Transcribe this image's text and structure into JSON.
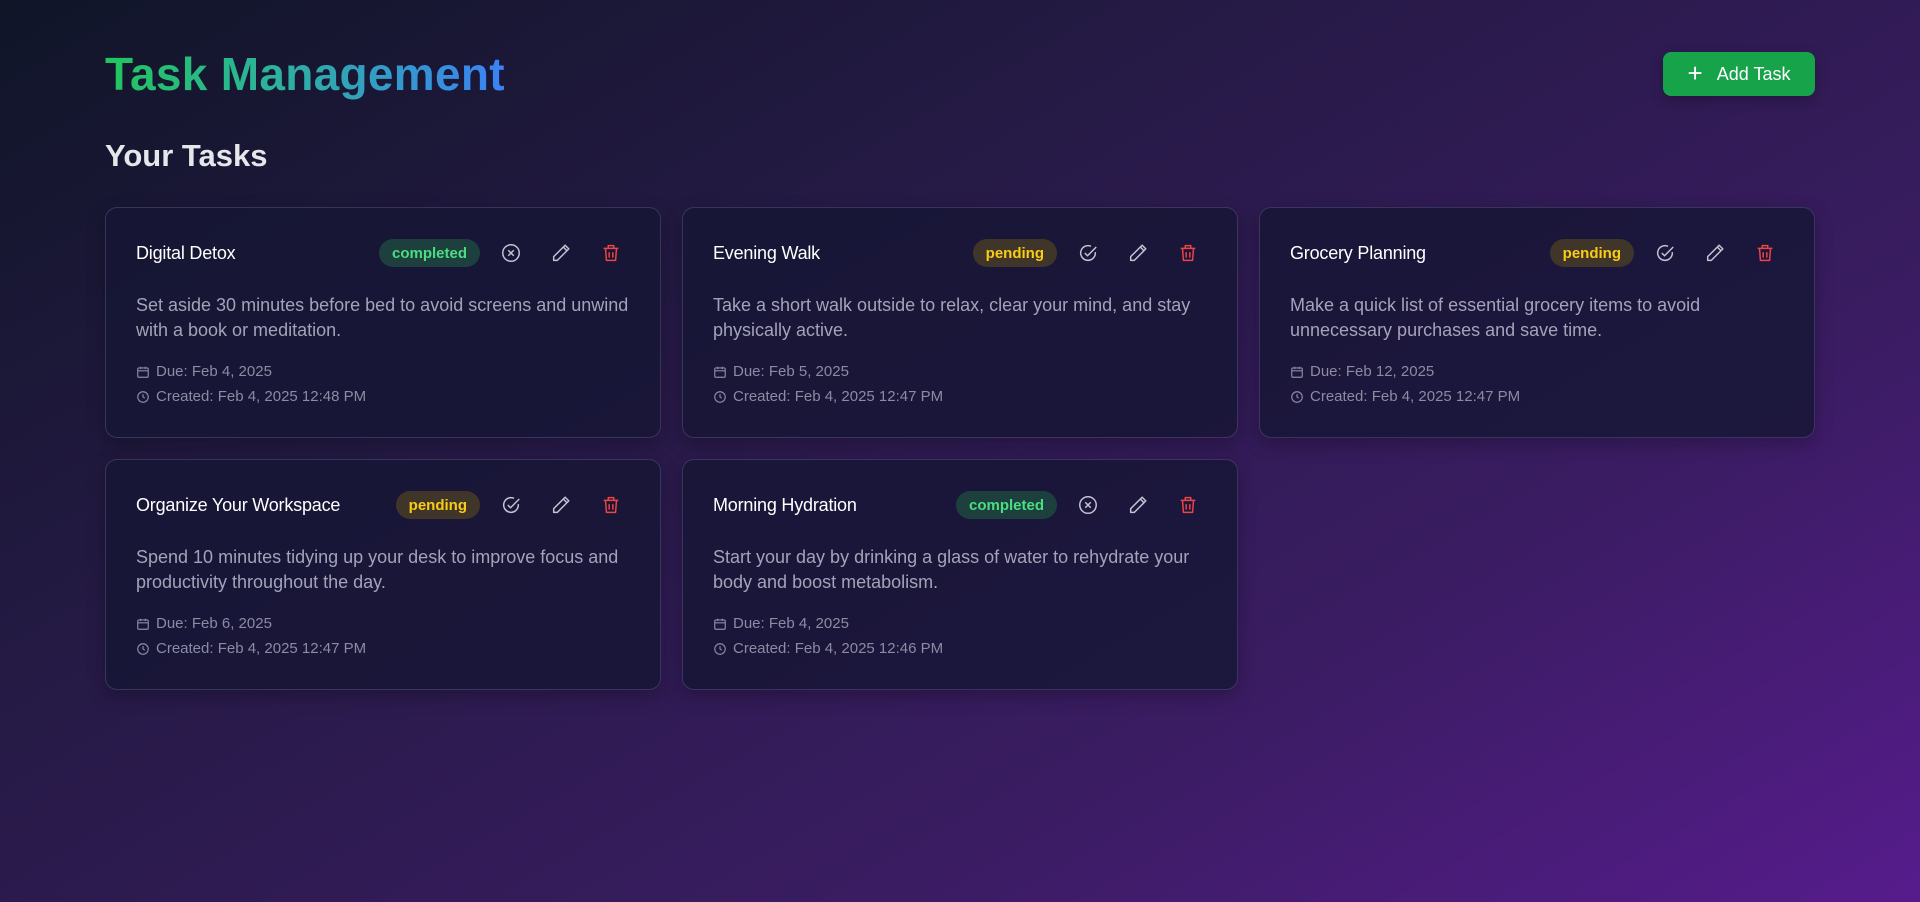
{
  "header": {
    "title": "Task Management",
    "add_button_label": "Add Task"
  },
  "section": {
    "title": "Your Tasks"
  },
  "tasks": [
    {
      "title": "Digital Detox",
      "status": "completed",
      "description": "Set aside 30 minutes before bed to avoid screens and unwind with a book or meditation.",
      "due": "Due: Feb 4, 2025",
      "created": "Created: Feb 4, 2025 12:48 PM",
      "toggle_icon": "x-circle-icon"
    },
    {
      "title": "Evening Walk",
      "status": "pending",
      "description": "Take a short walk outside to relax, clear your mind, and stay physically active.",
      "due": "Due: Feb 5, 2025",
      "created": "Created: Feb 4, 2025 12:47 PM",
      "toggle_icon": "check-circle-icon"
    },
    {
      "title": "Grocery Planning",
      "status": "pending",
      "description": "Make a quick list of essential grocery items to avoid unnecessary purchases and save time.",
      "due": "Due: Feb 12, 2025",
      "created": "Created: Feb 4, 2025 12:47 PM",
      "toggle_icon": "check-circle-icon"
    },
    {
      "title": "Organize Your Workspace",
      "status": "pending",
      "description": "Spend 10 minutes tidying up your desk to improve focus and productivity throughout the day.",
      "due": "Due: Feb 6, 2025",
      "created": "Created: Feb 4, 2025 12:47 PM",
      "toggle_icon": "check-circle-icon"
    },
    {
      "title": "Morning Hydration",
      "status": "completed",
      "description": "Start your day by drinking a glass of water to rehydrate your body and boost metabolism.",
      "due": "Due: Feb 4, 2025",
      "created": "Created: Feb 4, 2025 12:46 PM",
      "toggle_icon": "x-circle-icon"
    }
  ],
  "colors": {
    "accent_green": "#16a34a",
    "completed": "#4ade80",
    "pending": "#facc15",
    "delete": "#ef4444"
  }
}
